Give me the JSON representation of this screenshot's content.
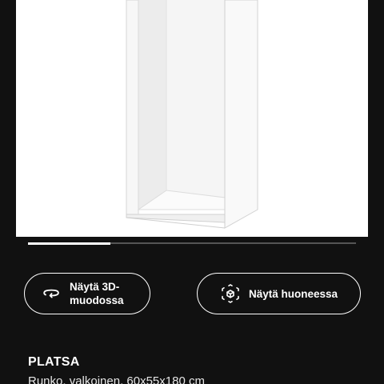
{
  "product_image": {
    "alt_icon": "wardrobe-frame-image"
  },
  "carousel": {
    "progress": 0.25
  },
  "actions": {
    "view_3d_label": "Näytä 3D-muodossa",
    "view_3d_icon": "rotate-3d-icon",
    "view_in_room_label": "Näytä huoneessa",
    "view_in_room_icon": "ar-cube-icon"
  },
  "product": {
    "name": "PLATSA",
    "description": "Runko, valkoinen, 60x55x180 cm"
  },
  "colors": {
    "background": "#111111",
    "image_background": "#ffffff",
    "text": "#ffffff"
  }
}
